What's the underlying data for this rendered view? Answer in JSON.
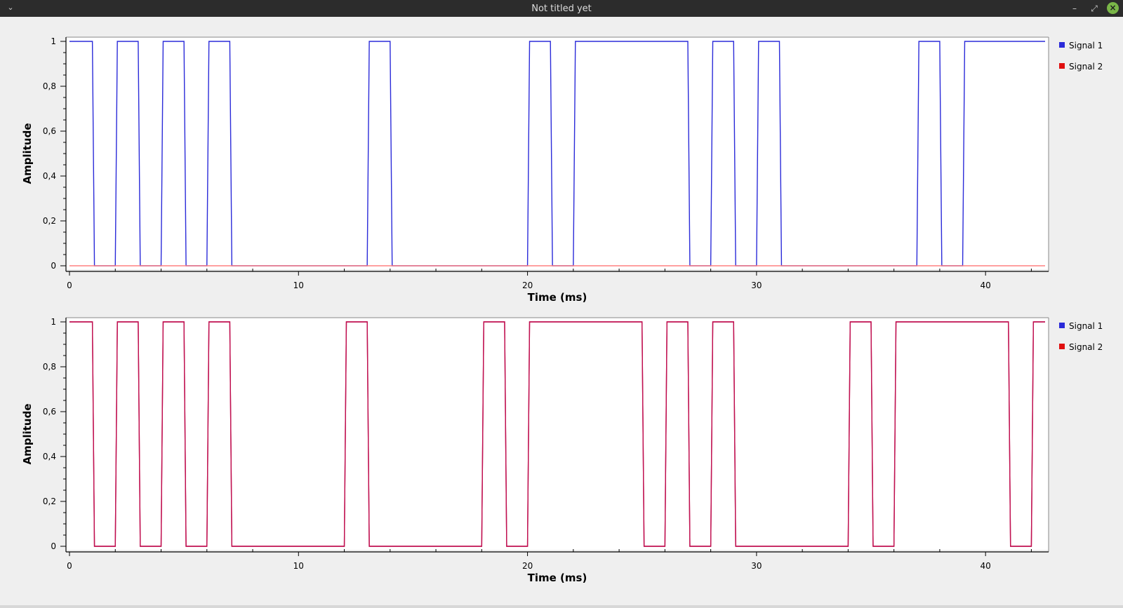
{
  "window": {
    "title": "Not titled yet",
    "menu_glyph": "⌄",
    "minimize_glyph": "–",
    "maximize_glyph": "⤢",
    "close_glyph": "×"
  },
  "colors": {
    "signal1": "#2b2bd9",
    "signal2": "#e01010",
    "overlap": "#c01050",
    "axis": "#000000",
    "zero_line": "#ff8080"
  },
  "chart_data": [
    {
      "type": "line",
      "xlabel": "Time (ms)",
      "ylabel": "Amplitude",
      "xlim": [
        0,
        42.6
      ],
      "ylim": [
        0,
        1
      ],
      "x_major_ticks": [
        0,
        10,
        20,
        30,
        40
      ],
      "x_major_tick_labels": [
        "0",
        "10",
        "20",
        "30",
        "40"
      ],
      "y_major_ticks": [
        0,
        0.2,
        0.4,
        0.6,
        0.8,
        1
      ],
      "y_major_tick_labels": [
        "0",
        "0,2",
        "0,4",
        "0,6",
        "0,8",
        "1"
      ],
      "legend": {
        "placement": "right",
        "entries": [
          "Signal 1",
          "Signal 2"
        ]
      },
      "series": [
        {
          "name": "Signal 1",
          "color": "#2b2bd9",
          "high_intervals": [
            [
              0,
              1
            ],
            [
              2,
              3
            ],
            [
              4,
              5
            ],
            [
              6,
              7
            ],
            [
              13,
              14
            ],
            [
              20,
              21
            ],
            [
              22,
              27
            ],
            [
              28,
              29
            ],
            [
              30,
              31
            ],
            [
              37,
              38
            ],
            [
              39,
              42.6
            ]
          ]
        },
        {
          "name": "Signal 2",
          "color": "#ff8080",
          "high_intervals": []
        }
      ]
    },
    {
      "type": "line",
      "xlabel": "Time (ms)",
      "ylabel": "Amplitude",
      "xlim": [
        0,
        42.6
      ],
      "ylim": [
        0,
        1
      ],
      "x_major_ticks": [
        0,
        10,
        20,
        30,
        40
      ],
      "x_major_tick_labels": [
        "0",
        "10",
        "20",
        "30",
        "40"
      ],
      "y_major_ticks": [
        0,
        0.2,
        0.4,
        0.6,
        0.8,
        1
      ],
      "y_major_tick_labels": [
        "0",
        "0,2",
        "0,4",
        "0,6",
        "0,8",
        "1"
      ],
      "legend": {
        "placement": "right",
        "entries": [
          "Signal 1",
          "Signal 2"
        ]
      },
      "series": [
        {
          "name": "Signal 1",
          "color": "#c01050",
          "high_intervals": [
            [
              0,
              1
            ],
            [
              2,
              3
            ],
            [
              4,
              5
            ],
            [
              6,
              7
            ],
            [
              12,
              13
            ],
            [
              18,
              19
            ],
            [
              20,
              25
            ],
            [
              26,
              27
            ],
            [
              28,
              29
            ],
            [
              34,
              35
            ],
            [
              36,
              41
            ],
            [
              42,
              42.6
            ]
          ]
        },
        {
          "name": "Signal 2",
          "color": "#c01050",
          "high_intervals": [
            [
              0,
              1
            ],
            [
              2,
              3
            ],
            [
              4,
              5
            ],
            [
              6,
              7
            ],
            [
              12,
              13
            ],
            [
              18,
              19
            ],
            [
              20,
              25
            ],
            [
              26,
              27
            ],
            [
              28,
              29
            ],
            [
              34,
              35
            ],
            [
              36,
              41
            ],
            [
              42,
              42.6
            ]
          ]
        }
      ]
    }
  ]
}
